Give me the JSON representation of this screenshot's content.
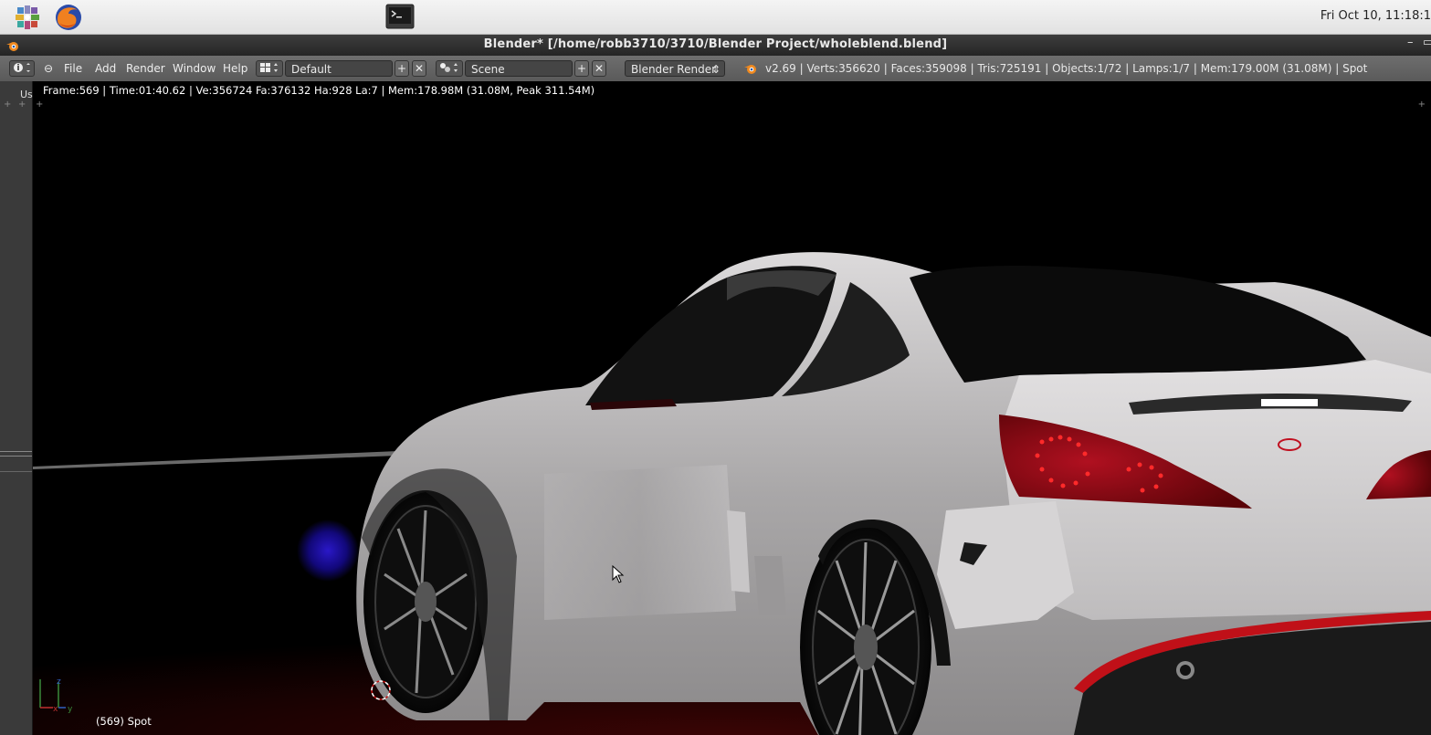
{
  "taskbar": {
    "apps": [
      {
        "name": "applications-menu-icon"
      },
      {
        "name": "firefox-icon"
      },
      {
        "name": "terminal-icon"
      }
    ],
    "clock": "Fri Oct 10, 11:18:1"
  },
  "window": {
    "title": "Blender* [/home/robb3710/3710/Blender Project/wholeblend.blend]"
  },
  "header": {
    "menus": [
      "File",
      "Add",
      "Render",
      "Window",
      "Help"
    ],
    "screen_layout": "Default",
    "scene": "Scene",
    "render_engine": "Blender Render",
    "stats": "v2.69 | Verts:356620 | Faces:359098 | Tris:725191 | Objects:1/72 | Lamps:1/7 | Mem:179.00M (31.08M) | Spot"
  },
  "viewport": {
    "render_info": "Frame:569 | Time:01:40.62 | Ve:356724 Fa:376132 Ha:928 La:7 | Mem:178.98M (31.08M, Peak 311.54M)",
    "object_label": "(569) Spot",
    "left_tab": "Us"
  },
  "colors": {
    "header_bg": "#626262",
    "title_bg": "#2f2f2f",
    "viewport_bg": "#000000",
    "taillight_red": "#8b0a12",
    "car_body": "#c9c7c8"
  }
}
